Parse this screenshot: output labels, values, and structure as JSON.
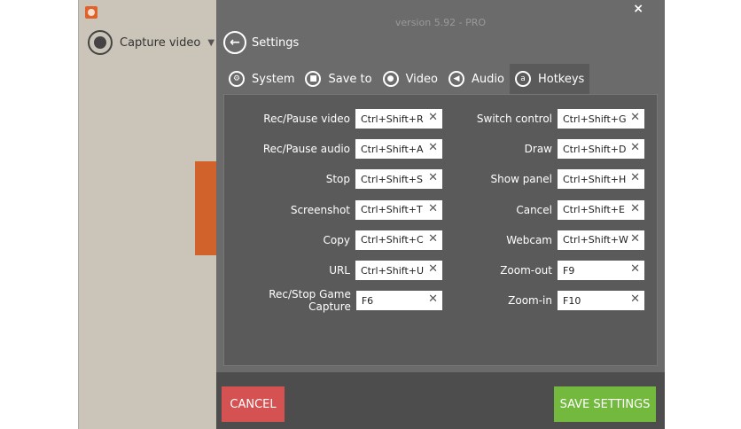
{
  "app": {
    "version": "version 5.92 - PRO",
    "mode": "Capture video",
    "close": "×"
  },
  "settings": {
    "title": "Settings"
  },
  "tabs": [
    {
      "label": "System"
    },
    {
      "label": "Save to"
    },
    {
      "label": "Video"
    },
    {
      "label": "Audio"
    },
    {
      "label": "Hotkeys",
      "active": true
    }
  ],
  "hotkeys_left": [
    {
      "label": "Rec/Pause video",
      "value": "Ctrl+Shift+R"
    },
    {
      "label": "Rec/Pause audio",
      "value": "Ctrl+Shift+A"
    },
    {
      "label": "Stop",
      "value": "Ctrl+Shift+S"
    },
    {
      "label": "Screenshot",
      "value": "Ctrl+Shift+T"
    },
    {
      "label": "Copy",
      "value": "Ctrl+Shift+C"
    },
    {
      "label": "URL",
      "value": "Ctrl+Shift+U"
    },
    {
      "label": "Rec/Stop Game Capture",
      "value": "F6"
    }
  ],
  "hotkeys_right": [
    {
      "label": "Switch control",
      "value": "Ctrl+Shift+G"
    },
    {
      "label": "Draw",
      "value": "Ctrl+Shift+D"
    },
    {
      "label": "Show panel",
      "value": "Ctrl+Shift+H"
    },
    {
      "label": "Cancel",
      "value": "Ctrl+Shift+E"
    },
    {
      "label": "Webcam",
      "value": "Ctrl+Shift+W"
    },
    {
      "label": "Zoom-out",
      "value": "F9"
    },
    {
      "label": "Zoom-in",
      "value": "F10"
    }
  ],
  "footer": {
    "cancel": "CANCEL",
    "save": "SAVE SETTINGS"
  },
  "colors": {
    "cancel": "#d55252",
    "save": "#72b93e",
    "accent": "#e0612a"
  }
}
